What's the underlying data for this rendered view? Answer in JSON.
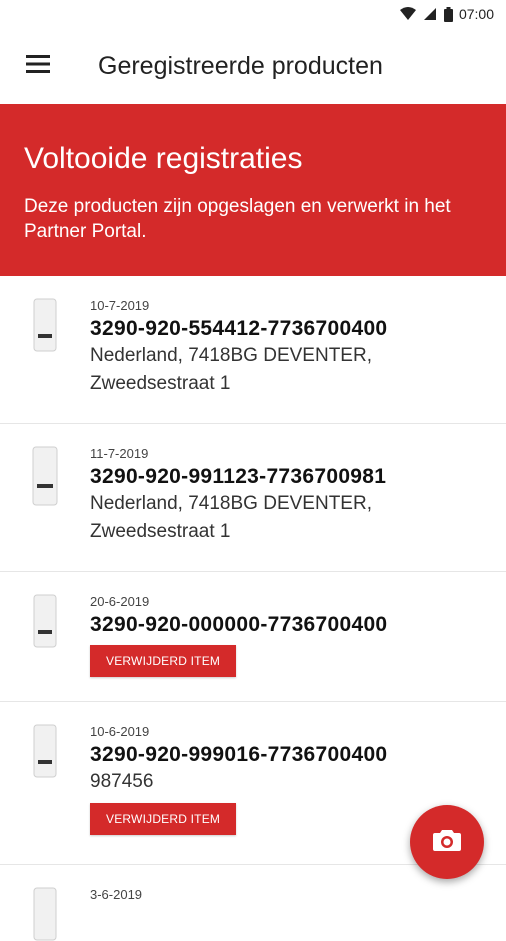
{
  "status_bar": {
    "time": "07:00"
  },
  "app_bar": {
    "title": "Geregistreerde producten"
  },
  "banner": {
    "heading": "Voltooide registraties",
    "subtitle": "Deze producten zijn opgeslagen en verwerkt in het Partner Portal."
  },
  "products": [
    {
      "date": "10-7-2019",
      "code": "3290-920-554412-7736700400",
      "address_line1": "Nederland, 7418BG DEVENTER,",
      "address_line2": "Zweedsestraat 1",
      "badge": ""
    },
    {
      "date": "11-7-2019",
      "code": "3290-920-991123-7736700981",
      "address_line1": "Nederland, 7418BG DEVENTER,",
      "address_line2": "Zweedsestraat 1",
      "badge": ""
    },
    {
      "date": "20-6-2019",
      "code": "3290-920-000000-7736700400",
      "address_line1": "",
      "address_line2": "",
      "badge": "VERWIJDERD ITEM"
    },
    {
      "date": "10-6-2019",
      "code": "3290-920-999016-7736700400",
      "address_line1": "987456",
      "address_line2": "",
      "badge": "VERWIJDERD ITEM"
    },
    {
      "date": "3-6-2019",
      "code": "",
      "address_line1": "",
      "address_line2": "",
      "badge": ""
    }
  ],
  "colors": {
    "accent": "#d42a2a",
    "divider": "#e6e6e6"
  },
  "icons": {
    "menu": "menu-icon",
    "fab": "camera-icon",
    "product": "boiler-icon"
  }
}
